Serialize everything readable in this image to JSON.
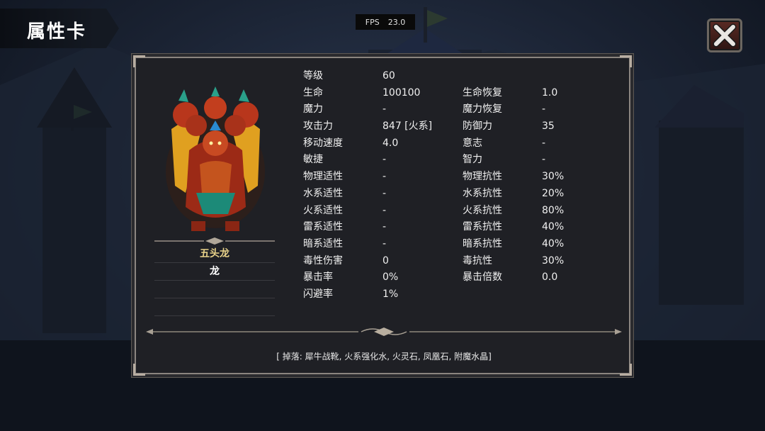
{
  "header": {
    "title": "属性卡"
  },
  "fps": {
    "label": "FPS",
    "value": "23.0"
  },
  "monster": {
    "name": "五头龙",
    "type": "龙"
  },
  "stats_left": [
    {
      "label": "等级",
      "value": "60"
    },
    {
      "label": "生命",
      "value": "100100"
    },
    {
      "label": "魔力",
      "value": "-"
    },
    {
      "label": "攻击力",
      "value": "847  [火系]"
    },
    {
      "label": "移动速度",
      "value": "4.0"
    },
    {
      "label": "敏捷",
      "value": "-"
    },
    {
      "label": "物理适性",
      "value": "-"
    },
    {
      "label": "水系适性",
      "value": "-"
    },
    {
      "label": "火系适性",
      "value": "-"
    },
    {
      "label": "雷系适性",
      "value": "-"
    },
    {
      "label": "暗系适性",
      "value": "-"
    },
    {
      "label": "毒性伤害",
      "value": "0"
    },
    {
      "label": "暴击率",
      "value": "0%"
    },
    {
      "label": "闪避率",
      "value": "1%"
    }
  ],
  "stats_right": [
    {
      "label": "",
      "value": ""
    },
    {
      "label": "生命恢复",
      "value": "1.0"
    },
    {
      "label": "魔力恢复",
      "value": "-"
    },
    {
      "label": "防御力",
      "value": "35"
    },
    {
      "label": "意志",
      "value": "-"
    },
    {
      "label": "智力",
      "value": "-"
    },
    {
      "label": "物理抗性",
      "value": "30%"
    },
    {
      "label": "水系抗性",
      "value": "20%"
    },
    {
      "label": "火系抗性",
      "value": "80%"
    },
    {
      "label": "雷系抗性",
      "value": "40%"
    },
    {
      "label": "暗系抗性",
      "value": "40%"
    },
    {
      "label": "毒抗性",
      "value": "30%"
    },
    {
      "label": "暴击倍数",
      "value": "0.0"
    },
    {
      "label": "",
      "value": ""
    }
  ],
  "drops": "[ 掉落: 犀牛战靴, 火系强化水, 火灵石, 凤凰石, 附魔水晶]",
  "colors": {
    "name_gold": "#e8d28a",
    "panel_bg": "#1f2025",
    "border": "#8b8580"
  },
  "icons": {
    "close": "close-x-icon",
    "portrait": "five-headed-dragon-portrait"
  }
}
